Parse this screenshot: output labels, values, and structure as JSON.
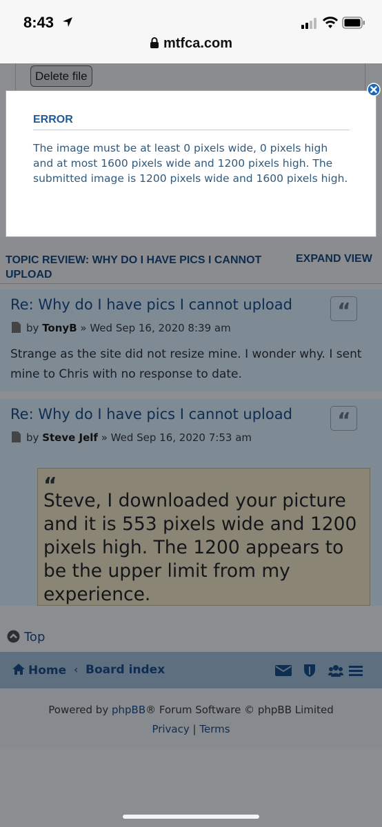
{
  "status_bar": {
    "time": "8:43",
    "url": "mtfca.com"
  },
  "upload": {
    "delete_label": "Delete file"
  },
  "modal": {
    "title": "ERROR",
    "message": "The image must be at least 0 pixels wide, 0 pixels high and at most 1600 pixels wide and 1200 pixels high. The submitted image is 1200 pixels wide and 1600 pixels high."
  },
  "topic_review": {
    "heading": "TOPIC REVIEW: WHY DO I HAVE PICS I CANNOT UPLOAD",
    "expand": "EXPAND VIEW"
  },
  "posts": [
    {
      "title": "Re: Why do I have pics I cannot upload",
      "by": "by",
      "author": "TonyB",
      "date": "» Wed Sep 16, 2020 8:39 am",
      "body": "Strange as the site did not resize mine. I wonder why. I sent mine to Chris with no response to date."
    },
    {
      "title": "Re: Why do I have pics I cannot upload",
      "by": "by",
      "author": "Steve Jelf",
      "date": "» Wed Sep 16, 2020 7:53 am",
      "quote": "Steve, I downloaded your picture and it is 553 pixels wide and 1200 pixels high. The 1200 appears to be the upper limit from my experience."
    }
  ],
  "top_link": "Top",
  "navbar": {
    "home": "Home",
    "separator": "‹",
    "board_index": "Board index"
  },
  "footer": {
    "powered_prefix": "Powered by ",
    "phpbb": "phpBB",
    "powered_suffix": "® Forum Software © phpBB Limited",
    "privacy": "Privacy",
    "separator": "|",
    "terms": "Terms"
  }
}
